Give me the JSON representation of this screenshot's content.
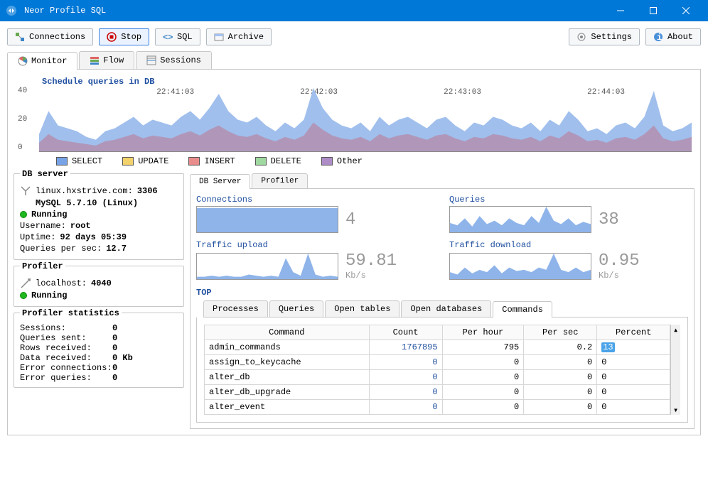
{
  "window": {
    "title": "Neor Profile SQL"
  },
  "toolbar": {
    "connections": "Connections",
    "stop": "Stop",
    "sql": "SQL",
    "archive": "Archive",
    "settings": "Settings",
    "about": "About"
  },
  "tabs": {
    "monitor": "Monitor",
    "flow": "Flow",
    "sessions": "Sessions"
  },
  "chart_data": {
    "type": "area",
    "title": "Schedule queries in DB",
    "ylim": [
      0,
      40
    ],
    "yticks": [
      0,
      20,
      40
    ],
    "xticks": [
      "22:41:03",
      "22:42:03",
      "22:43:03",
      "22:44:03"
    ],
    "legend": [
      "SELECT",
      "UPDATE",
      "INSERT",
      "DELETE",
      "Other"
    ],
    "legend_colors": [
      "#77a3e6",
      "#f3d26b",
      "#e98c8c",
      "#9fd99f",
      "#ae8cc7"
    ],
    "series": [
      {
        "name": "SELECT",
        "values": [
          12,
          28,
          18,
          16,
          14,
          10,
          8,
          14,
          16,
          20,
          24,
          18,
          22,
          20,
          18,
          24,
          28,
          22,
          30,
          40,
          28,
          22,
          20,
          24,
          18,
          14,
          20,
          16,
          22,
          44,
          30,
          22,
          18,
          16,
          20,
          14,
          24,
          18,
          22,
          24,
          20,
          16,
          22,
          24,
          18,
          14,
          20,
          18,
          24,
          22,
          18,
          16,
          20,
          14,
          22,
          18,
          28,
          22,
          14,
          16,
          12,
          18,
          20,
          16,
          24,
          42,
          18,
          14,
          16,
          20
        ]
      },
      {
        "name": "INSERT",
        "values": [
          6,
          12,
          8,
          7,
          6,
          5,
          4,
          7,
          8,
          10,
          12,
          9,
          11,
          10,
          9,
          12,
          14,
          11,
          15,
          18,
          14,
          11,
          10,
          12,
          9,
          7,
          10,
          8,
          11,
          20,
          15,
          11,
          9,
          8,
          10,
          7,
          12,
          9,
          11,
          12,
          10,
          8,
          11,
          12,
          9,
          7,
          10,
          9,
          12,
          11,
          9,
          8,
          10,
          7,
          11,
          9,
          14,
          11,
          7,
          8,
          6,
          9,
          10,
          8,
          12,
          18,
          9,
          7,
          8,
          10
        ]
      }
    ]
  },
  "db": {
    "title": "DB server",
    "host": "linux.hxstrive.com:",
    "port": "3306",
    "version": "MySQL 5.7.10 (Linux)",
    "status": "Running",
    "username_k": "Username:",
    "username_v": "root",
    "uptime_k": "Uptime:",
    "uptime_v": "92 days 05:39",
    "qps_k": "Queries per sec:",
    "qps_v": "12.7"
  },
  "profiler": {
    "title": "Profiler",
    "host": "localhost:",
    "port": "4040",
    "status": "Running"
  },
  "stats": {
    "title": "Profiler statistics",
    "rows": [
      {
        "k": "Sessions:",
        "v": "0"
      },
      {
        "k": "Queries sent:",
        "v": "0"
      },
      {
        "k": "Rows received:",
        "v": "0"
      },
      {
        "k": "Data received:",
        "v": "0 Kb"
      },
      {
        "k": "Error connections:",
        "v": "0"
      },
      {
        "k": "Error queries:",
        "v": "0"
      }
    ]
  },
  "subtabs": {
    "dbserver": "DB Server",
    "profiler": "Profiler"
  },
  "metrics": {
    "connections": {
      "label": "Connections",
      "value": "4",
      "unit": ""
    },
    "queries": {
      "label": "Queries",
      "value": "38",
      "unit": ""
    },
    "upload": {
      "label": "Traffic upload",
      "value": "59.81",
      "unit": "Kb/s"
    },
    "download": {
      "label": "Traffic download",
      "value": "0.95",
      "unit": "Kb/s"
    }
  },
  "top": {
    "label": "TOP",
    "tabs": [
      "Processes",
      "Queries",
      "Open tables",
      "Open databases",
      "Commands"
    ],
    "headers": [
      "Command",
      "Count",
      "Per hour",
      "Per sec",
      "Percent"
    ],
    "rows": [
      {
        "cmd": "admin_commands",
        "count": "1767895",
        "perhour": "795",
        "persec": "0.2",
        "percent": "13"
      },
      {
        "cmd": "assign_to_keycache",
        "count": "0",
        "perhour": "0",
        "persec": "0",
        "percent": "0"
      },
      {
        "cmd": "alter_db",
        "count": "0",
        "perhour": "0",
        "persec": "0",
        "percent": "0"
      },
      {
        "cmd": "alter_db_upgrade",
        "count": "0",
        "perhour": "0",
        "persec": "0",
        "percent": "0"
      },
      {
        "cmd": "alter_event",
        "count": "0",
        "perhour": "0",
        "persec": "0",
        "percent": "0"
      }
    ]
  }
}
